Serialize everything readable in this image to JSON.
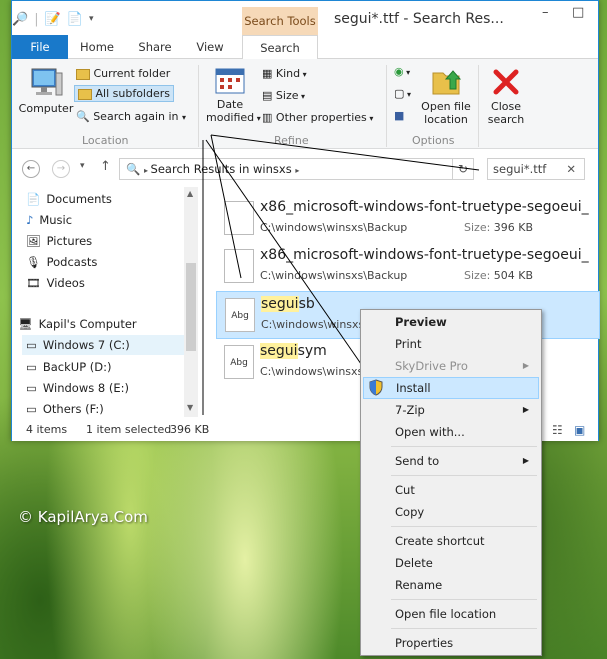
{
  "titlebar": {
    "context_tab": "Search Tools",
    "window_title": "segui*.ttf - Search Res...",
    "minimize": "–",
    "maximize": "□"
  },
  "tabs": [
    "File",
    "Home",
    "Share",
    "View",
    "Search"
  ],
  "ribbon": {
    "location": {
      "computer": "Computer",
      "current_folder": "Current folder",
      "all_subfolders": "All subfolders",
      "search_again": "Search again in",
      "label": "Location"
    },
    "refine": {
      "date_modified_1": "Date",
      "date_modified_2": "modified",
      "kind": "Kind",
      "size": "Size",
      "other_properties": "Other properties",
      "label": "Refine"
    },
    "options": {
      "open_file_location_1": "Open file",
      "open_file_location_2": "location",
      "label": "Options"
    },
    "close_search_1": "Close",
    "close_search_2": "search"
  },
  "address": {
    "path": "Search Results in winsxs",
    "search_value": "segui*.ttf",
    "clear": "✕"
  },
  "nav": {
    "items": [
      "Documents",
      "Music",
      "Pictures",
      "Podcasts",
      "Videos"
    ],
    "computer": "Kapil's Computer",
    "drives": [
      "Windows 7 (C:)",
      "BackUP (D:)",
      "Windows 8 (E:)",
      "Others (F:)"
    ]
  },
  "files": [
    {
      "name": "x86_microsoft-windows-font-truetype-segoeui_...",
      "path": "C:\\windows\\winsxs\\Backup",
      "size_label": "Size:",
      "size": "396 KB"
    },
    {
      "name": "x86_microsoft-windows-font-truetype-segoeui_...",
      "path": "C:\\windows\\winsxs\\Backup",
      "size_label": "Size:",
      "size": "504 KB"
    },
    {
      "name_hl": "segui",
      "name_rest": "sb",
      "path": "C:\\windows\\winsxs",
      "icon": "Abg"
    },
    {
      "name_hl": "segui",
      "name_rest": "sym",
      "path": "C:\\windows\\winsxs",
      "icon": "Abg"
    }
  ],
  "status": {
    "items": "4 items",
    "selected": "1 item selected",
    "size": "396 KB"
  },
  "context_menu": {
    "preview": "Preview",
    "print": "Print",
    "skydrive": "SkyDrive Pro",
    "install": "Install",
    "sevenzip": "7-Zip",
    "open_with": "Open with...",
    "send_to": "Send to",
    "cut": "Cut",
    "copy": "Copy",
    "create_shortcut": "Create shortcut",
    "delete": "Delete",
    "rename": "Rename",
    "open_file_location": "Open file location",
    "properties": "Properties"
  },
  "watermark": "© KapilArya.Com",
  "colors": {
    "file_tab": "#1979ca",
    "search_tools": "#f6d9b8",
    "selection": "#cce8ff",
    "highlight": "#fff19c"
  }
}
